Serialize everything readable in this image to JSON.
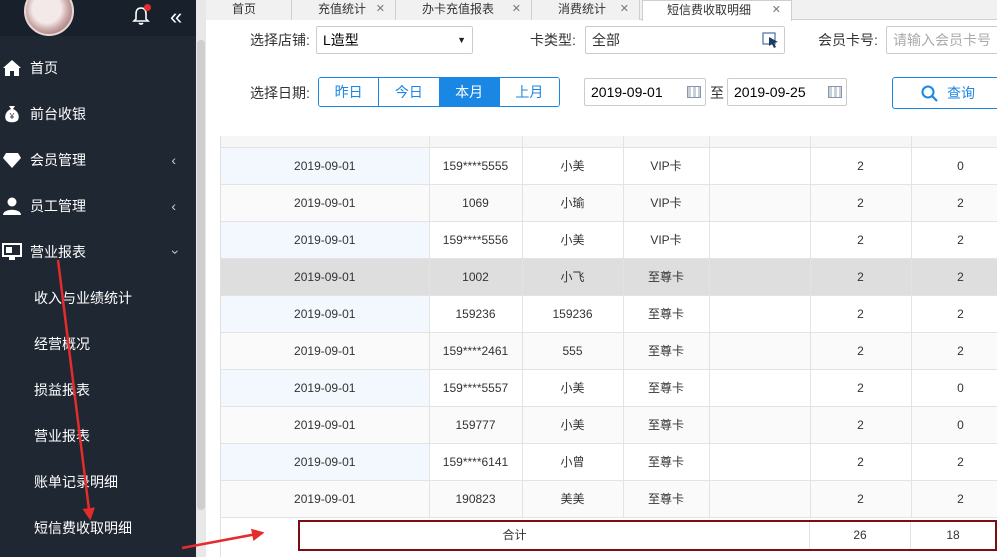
{
  "sidebar": {
    "items": [
      {
        "label": "首页",
        "icon": "home-icon"
      },
      {
        "label": "前台收银",
        "icon": "money-bag-icon"
      },
      {
        "label": "会员管理",
        "icon": "diamond-icon"
      },
      {
        "label": "员工管理",
        "icon": "user-icon"
      },
      {
        "label": "营业报表",
        "icon": "monitor-icon"
      }
    ],
    "subitems": [
      "收入与业绩统计",
      "经营概况",
      "损益报表",
      "营业报表",
      "账单记录明细",
      "短信费收取明细"
    ]
  },
  "tabs": [
    {
      "label": "首页"
    },
    {
      "label": "充值统计"
    },
    {
      "label": "办卡充值报表"
    },
    {
      "label": "消费统计"
    },
    {
      "label": "短信费收取明细"
    }
  ],
  "filters": {
    "store_label": "选择店铺:",
    "store_value": "L造型",
    "card_type_label": "卡类型:",
    "card_type_value": "全部",
    "member_card_label": "会员卡号:",
    "member_card_placeholder": "请输入会员卡号",
    "date_label": "选择日期:",
    "date_options": [
      "昨日",
      "今日",
      "本月",
      "上月"
    ],
    "date_selected": "本月",
    "date_from": "2019-09-01",
    "date_sep": "至",
    "date_to": "2019-09-25",
    "query_label": "查询"
  },
  "table": {
    "rows": [
      [
        "2019-09-01",
        "159****5555",
        "小美",
        "VIP卡",
        "",
        "2",
        "0"
      ],
      [
        "2019-09-01",
        "1069",
        "小瑜",
        "VIP卡",
        "",
        "2",
        "2"
      ],
      [
        "2019-09-01",
        "159****5556",
        "小美",
        "VIP卡",
        "",
        "2",
        "2"
      ],
      [
        "2019-09-01",
        "1002",
        "小飞",
        "至尊卡",
        "",
        "2",
        "2"
      ],
      [
        "2019-09-01",
        "159236",
        "159236",
        "至尊卡",
        "",
        "2",
        "2"
      ],
      [
        "2019-09-01",
        "159****2461",
        "555",
        "至尊卡",
        "",
        "2",
        "2"
      ],
      [
        "2019-09-01",
        "159****5557",
        "小美",
        "至尊卡",
        "",
        "2",
        "0"
      ],
      [
        "2019-09-01",
        "159777",
        "小美",
        "至尊卡",
        "",
        "2",
        "0"
      ],
      [
        "2019-09-01",
        "159****6141",
        "小曾",
        "至尊卡",
        "",
        "2",
        "2"
      ],
      [
        "2019-09-01",
        "190823",
        "美美",
        "至尊卡",
        "",
        "2",
        "2"
      ]
    ],
    "total_label": "合计",
    "total_a": "26",
    "total_b": "18"
  },
  "colors": {
    "accent": "#1a87e5",
    "sidebar": "#1f2733",
    "annotation": "#e52b2b",
    "total_border": "#7a0d14"
  }
}
